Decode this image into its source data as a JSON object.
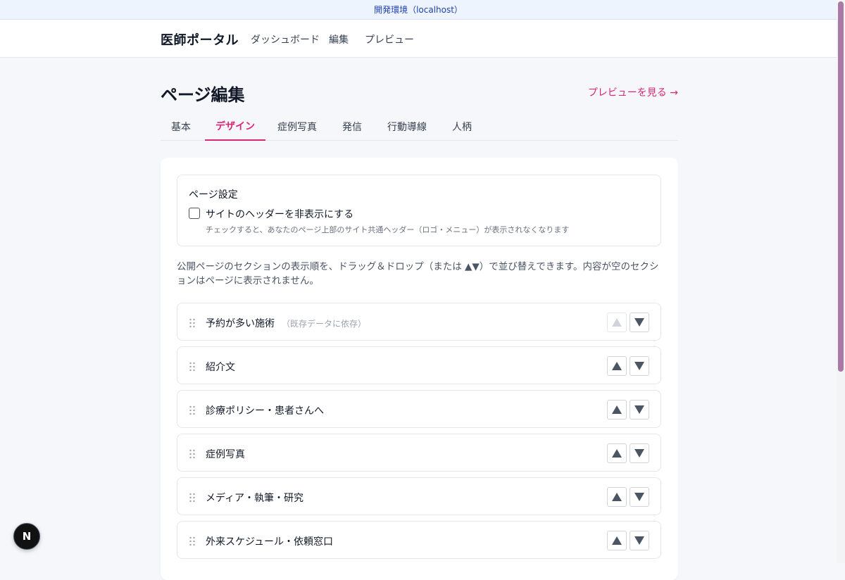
{
  "env_banner": "開発環境（localhost）",
  "header": {
    "brand": "医師ポータル",
    "nav": [
      "ダッシュボード",
      "編集",
      "プレビュー"
    ]
  },
  "page": {
    "title": "ページ編集",
    "preview_link": "プレビューを見る →"
  },
  "tabs": [
    {
      "label": "基本",
      "active": false
    },
    {
      "label": "デザイン",
      "active": true
    },
    {
      "label": "症例写真",
      "active": false
    },
    {
      "label": "発信",
      "active": false
    },
    {
      "label": "行動導線",
      "active": false
    },
    {
      "label": "人柄",
      "active": false
    }
  ],
  "settings": {
    "title": "ページ設定",
    "checkbox_label": "サイトのヘッダーを非表示にする",
    "checkbox_checked": false,
    "checkbox_help": "チェックすると、あなたのページ上部のサイト共通ヘッダー（ロゴ・メニュー）が表示されなくなります"
  },
  "instructions": "公開ページのセクションの表示順を、ドラッグ＆ドロップ（または ▲▼）で並び替えできます。内容が空のセクションはページに表示されません。",
  "sections": [
    {
      "label": "予約が多い施術",
      "note": "（既存データに依存）",
      "up_disabled": true
    },
    {
      "label": "紹介文",
      "note": "",
      "up_disabled": false
    },
    {
      "label": "診療ポリシー・患者さんへ",
      "note": "",
      "up_disabled": false
    },
    {
      "label": "症例写真",
      "note": "",
      "up_disabled": false
    },
    {
      "label": "メディア・執筆・研究",
      "note": "",
      "up_disabled": false
    },
    {
      "label": "外来スケジュール・依頼窓口",
      "note": "",
      "up_disabled": false
    }
  ],
  "badge": "N",
  "colors": {
    "accent": "#db2777",
    "env_text": "#1e40af",
    "arrow": "#4b5563",
    "arrow_disabled": "#d1d5db"
  }
}
